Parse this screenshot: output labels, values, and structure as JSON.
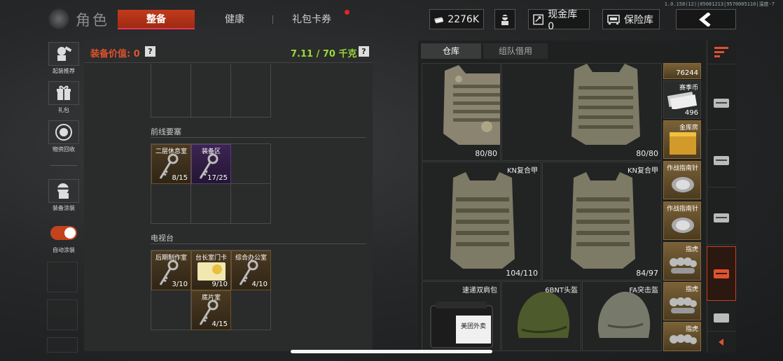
{
  "version": "1.0.158(12)|05081213|9570005110|温度-7",
  "header": {
    "title": "角色",
    "tabs": [
      {
        "label": "整备",
        "active": true
      },
      {
        "label": "健康",
        "active": false
      },
      {
        "label": "礼包卡券",
        "active": false,
        "badge": true
      }
    ],
    "currency": "2276K",
    "cash_vault": "现金库 0",
    "safe_vault": "保险库"
  },
  "sidebar": {
    "items": [
      {
        "label": "起装推荐",
        "icon": "loadout-icon"
      },
      {
        "label": "礼包",
        "icon": "gift-icon"
      },
      {
        "label": "物资回收",
        "icon": "recycle-icon"
      },
      {
        "label": "装备涂装",
        "icon": "paint-icon"
      },
      {
        "label": "自动涂装",
        "icon": "toggle-icon",
        "toggle_on": true
      }
    ]
  },
  "equipment": {
    "value_label": "装备价值: 0",
    "weight": "7.11 / 70 千克",
    "sections": [
      {
        "title": "前线要塞",
        "keys": [
          {
            "name": "二层休息室",
            "count": "8/15",
            "rarity": "gold"
          },
          {
            "name": "装备区",
            "count": "17/25",
            "rarity": "purple"
          }
        ]
      },
      {
        "title": "电视台",
        "keys": [
          {
            "name": "后期制作室",
            "count": "3/10",
            "rarity": "gold"
          },
          {
            "name": "台长室门卡",
            "count": "9/10",
            "rarity": "gold"
          },
          {
            "name": "综合办公室",
            "count": "4/10",
            "rarity": "gold"
          },
          {
            "name": "底片室",
            "count": "4/15",
            "rarity": "gold"
          }
        ]
      }
    ]
  },
  "storage": {
    "tabs": [
      {
        "label": "仓库",
        "active": true
      },
      {
        "label": "组队借用",
        "active": false
      }
    ],
    "items": [
      {
        "name": "",
        "count": "80/80"
      },
      {
        "name": "",
        "count": "80/80"
      },
      {
        "name": "KN复合甲",
        "count": "104/110"
      },
      {
        "name": "KN复合甲",
        "count": "84/97"
      },
      {
        "name": "速递双肩包",
        "count": "",
        "print": "美团外卖"
      },
      {
        "name": "6BNT头盔",
        "count": ""
      },
      {
        "name": "FA突击盔",
        "count": ""
      }
    ],
    "side_items": [
      {
        "name": "",
        "count": "76244"
      },
      {
        "name": "赛季币",
        "count": "496"
      },
      {
        "name": "金库房",
        "count": ""
      },
      {
        "name": "作战指南针",
        "count": ""
      },
      {
        "name": "作战指南针",
        "count": ""
      },
      {
        "name": "指虎",
        "count": ""
      },
      {
        "name": "指虎",
        "count": ""
      },
      {
        "name": "指虎",
        "count": ""
      }
    ]
  },
  "colors": {
    "accent": "#c2431c",
    "weight_green": "#9bd83a",
    "value_red": "#e0522e"
  }
}
